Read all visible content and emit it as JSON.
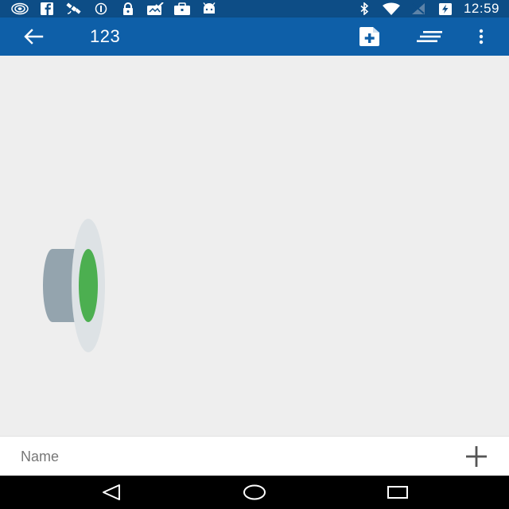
{
  "status_bar": {
    "left_icons": [
      "target-icon",
      "facebook-icon",
      "satellite-icon",
      "circle-info-icon",
      "lock-icon",
      "photo-check-icon",
      "briefcase-icon",
      "android-icon"
    ],
    "right_icons": [
      "bluetooth-icon",
      "wifi-icon",
      "signal-off-icon",
      "battery-charging-icon"
    ],
    "time": "12:59"
  },
  "app_bar": {
    "title": "123",
    "back_icon": "arrow-left-icon",
    "actions": [
      "add-file-icon",
      "sort-lines-icon",
      "more-vertical-icon"
    ]
  },
  "canvas": {
    "object": "cylinder-node-icon",
    "colors": {
      "body": "#94a4ae",
      "face": "#dde2e5",
      "core": "#4caf50"
    }
  },
  "bottom_bar": {
    "placeholder": "Name",
    "add_icon": "plus-icon"
  },
  "nav_bar": {
    "buttons": [
      "back-triangle-icon",
      "home-circle-icon",
      "recents-square-icon"
    ]
  },
  "colors": {
    "status_bar": "#0d4d86",
    "app_bar": "#0e5fa8",
    "canvas": "#eeeeee"
  }
}
